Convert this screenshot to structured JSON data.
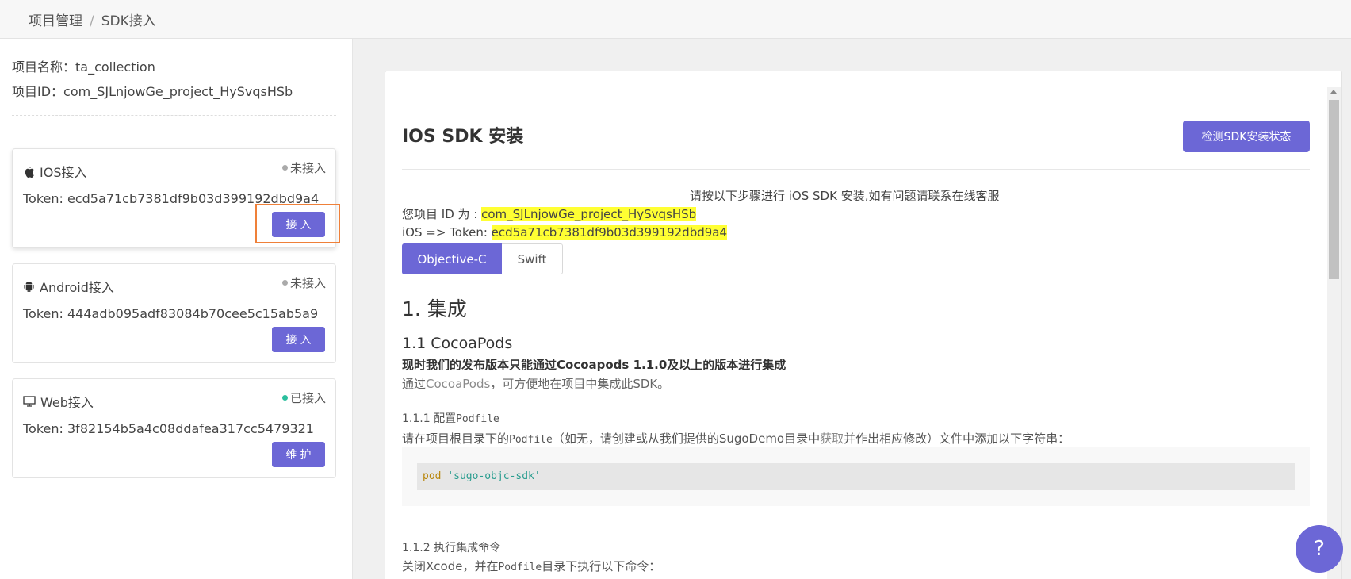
{
  "breadcrumb": {
    "parent": "项目管理",
    "separator": "/",
    "current": "SDK接入"
  },
  "project": {
    "name_line": "项目名称：ta_collection",
    "id_line": "项目ID：com_SJLnjowGe_project_HySvqsHSb"
  },
  "cards": [
    {
      "label": "IOS接入",
      "icon": "apple-icon",
      "status": "未接入",
      "token": "Token: ecd5a71cb7381df9b03d399192dbd9a4",
      "button": "接入"
    },
    {
      "label": "Android接入",
      "icon": "android-icon",
      "status": "未接入",
      "token": "Token: 444adb095adf83084b70cee5c15ab5a9",
      "button": "接入"
    },
    {
      "label": "Web接入",
      "icon": "monitor-icon",
      "status": "已接入",
      "token": "Token: 3f82154b5a4c08ddafea317cc5479321",
      "button": "维护"
    }
  ],
  "main": {
    "title": "IOS SDK 安装",
    "check_button": "检测SDK安装状态",
    "intro": "请按以下步骤进行 iOS SDK 安装,如有问题请联系在线客服",
    "project_id_label": "您项目 ID 为 : ",
    "project_id_value": "com_SJLnjowGe_project_HySvqsHSb",
    "token_label": "iOS => Token: ",
    "token_value": "ecd5a71cb7381df9b03d399192dbd9a4",
    "tabs": [
      "Objective-C",
      "Swift"
    ],
    "h1": "1. 集成",
    "h2": "1.1 CocoaPods",
    "bold_line": "现时我们的发布版本只能通过Cocoapods 1.1.0及以上的版本进行集成",
    "sub_pre": "通过",
    "sub_link": "CocoaPods",
    "sub_post": "，可方便地在项目中集成此SDK。",
    "h3_1_pre": "1.1.1 配置",
    "h3_1_code": "Podfile",
    "line1_pre": "请在项目根目录下的",
    "line1_code": "Podfile",
    "line1_mid": "（如无，请创建或从我们提供的SugoDemo目录中",
    "line1_link": "获取",
    "line1_post": "并作出相应修改）文件中添加以下字符串：",
    "code_kw": "pod",
    "code_str": "'sugo-objc-sdk'",
    "h3_2": "1.1.2 执行集成命令",
    "line2_pre": "关闭Xcode，并在",
    "line2_code": "Podfile",
    "line2_post": "目录下执行以下命令："
  },
  "help": "?",
  "colors": {
    "primary": "#6c67d6",
    "highlight": "#ffff33",
    "annotation": "#ef8039",
    "connected_dot": "#2bbf9e"
  }
}
